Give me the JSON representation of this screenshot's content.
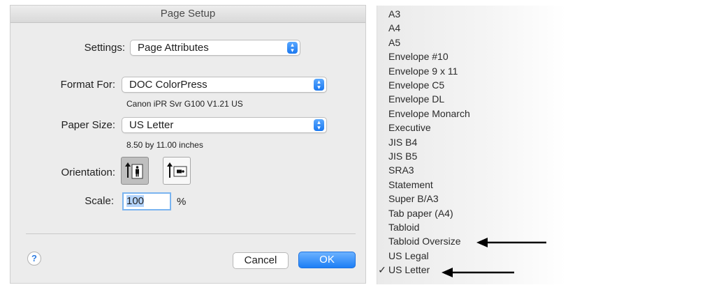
{
  "dialog": {
    "title": "Page Setup",
    "settings": {
      "label": "Settings:",
      "value": "Page Attributes"
    },
    "format_for": {
      "label": "Format For:",
      "value": "DOC ColorPress",
      "detail": "Canon iPR Svr G100 V1.21 US"
    },
    "paper_size": {
      "label": "Paper Size:",
      "value": "US Letter",
      "detail": "8.50 by 11.00 inches"
    },
    "orientation": {
      "label": "Orientation:",
      "selected": "portrait"
    },
    "scale": {
      "label": "Scale:",
      "value": "100",
      "unit": "%"
    },
    "help_label": "?",
    "cancel_label": "Cancel",
    "ok_label": "OK",
    "accent_color": "#1d7ef5"
  },
  "paper_list": {
    "items": [
      "A3",
      "A4",
      "A5",
      "Envelope #10",
      "Envelope 9 x 11",
      "Envelope C5",
      "Envelope DL",
      "Envelope Monarch",
      "Executive",
      "JIS B4",
      "JIS B5",
      "SRA3",
      "Statement",
      "Super B/A3",
      "Tab paper (A4)",
      "Tabloid",
      "Tabloid Oversize",
      "US Legal",
      "US Letter"
    ],
    "checked_item": "US Letter",
    "check_mark": "✓"
  }
}
